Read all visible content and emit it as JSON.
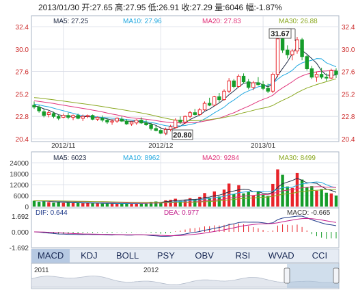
{
  "header": "2013/01/30 开:27.65 高:27.95 低:26.91 收:27.29 量:6046 幅:-1.87%",
  "colors": {
    "up": "#e8242a",
    "down": "#159c2a",
    "ma5": "#1f2a44",
    "ma10": "#21a8e0",
    "ma20": "#e0337a",
    "ma30": "#8aa81f",
    "grid": "#d8dce6",
    "axis": "#6d7a8a",
    "price_label": "#cc2a2a"
  },
  "price_panel": {
    "legend": [
      {
        "key": "ma5",
        "text": "MA5: 27.25"
      },
      {
        "key": "ma10",
        "text": "MA10: 27.96"
      },
      {
        "key": "ma20",
        "text": "MA20: 27.83"
      },
      {
        "key": "ma30",
        "text": "MA30: 26.88"
      }
    ],
    "y_ticks": [
      "32.4",
      "30.0",
      "27.6",
      "25.2",
      "22.8",
      "20.4"
    ],
    "x_ticks": [
      "2012/11",
      "2012/12",
      "2013/01"
    ],
    "high_callout": "31.67",
    "low_callout": "20.80"
  },
  "volume_panel": {
    "legend": [
      {
        "key": "ma5",
        "text": "MA5: 6023"
      },
      {
        "key": "ma10",
        "text": "MA10: 8962"
      },
      {
        "key": "ma20",
        "text": "MA20: 9284"
      },
      {
        "key": "ma30",
        "text": "MA30: 8499"
      }
    ],
    "y_ticks": [
      "24000",
      "18000",
      "12000",
      "6000",
      "0"
    ]
  },
  "macd_panel": {
    "dif": "DIF: 0.644",
    "dea": "DEA: 0.977",
    "macd": "MACD: -0.665",
    "y_ticks": [
      "1.692",
      "0.000",
      "-1.692"
    ]
  },
  "tabs": [
    "MACD",
    "KDJ",
    "BOLL",
    "PSY",
    "OBV",
    "RSI",
    "WVAD",
    "CCI"
  ],
  "active_tab": "MACD",
  "navigator": {
    "labels": [
      "2011",
      "2012"
    ]
  },
  "chart_data": [
    {
      "type": "candlestick",
      "ylim": [
        20.4,
        32.4
      ],
      "ohlc": [
        [
          24.0,
          24.4,
          23.6,
          23.8
        ],
        [
          23.8,
          24.0,
          23.2,
          23.4
        ],
        [
          23.3,
          23.6,
          22.7,
          22.9
        ],
        [
          23.0,
          23.4,
          22.7,
          23.2
        ],
        [
          23.1,
          23.3,
          22.6,
          22.8
        ],
        [
          22.8,
          23.0,
          22.4,
          22.6
        ],
        [
          22.7,
          23.1,
          22.6,
          22.9
        ],
        [
          22.9,
          23.2,
          22.5,
          22.7
        ],
        [
          22.7,
          23.0,
          22.4,
          22.9
        ],
        [
          22.9,
          23.1,
          22.5,
          22.6
        ],
        [
          22.6,
          23.0,
          22.3,
          22.8
        ],
        [
          22.8,
          23.0,
          22.6,
          22.9
        ],
        [
          22.9,
          23.0,
          22.4,
          22.5
        ],
        [
          22.5,
          22.8,
          22.3,
          22.7
        ],
        [
          22.6,
          22.9,
          22.2,
          22.4
        ],
        [
          22.4,
          22.6,
          22.0,
          22.2
        ],
        [
          22.2,
          22.5,
          21.9,
          22.3
        ],
        [
          22.3,
          22.7,
          22.1,
          22.6
        ],
        [
          22.5,
          22.8,
          22.2,
          22.3
        ],
        [
          22.3,
          22.5,
          21.9,
          22.0
        ],
        [
          22.0,
          22.3,
          21.8,
          22.2
        ],
        [
          22.1,
          22.5,
          21.9,
          22.4
        ],
        [
          22.4,
          22.7,
          22.0,
          22.1
        ],
        [
          22.1,
          22.4,
          21.8,
          21.9
        ],
        [
          21.9,
          22.1,
          21.3,
          21.5
        ],
        [
          21.5,
          21.8,
          21.2,
          21.3
        ],
        [
          21.3,
          21.5,
          20.9,
          21.0
        ],
        [
          21.0,
          21.6,
          20.8,
          21.4
        ],
        [
          21.4,
          21.9,
          21.2,
          21.7
        ],
        [
          21.6,
          22.6,
          21.5,
          22.4
        ],
        [
          22.4,
          22.8,
          22.0,
          22.2
        ],
        [
          22.2,
          22.9,
          22.0,
          22.8
        ],
        [
          22.8,
          23.4,
          22.6,
          23.2
        ],
        [
          23.2,
          23.6,
          22.9,
          23.0
        ],
        [
          23.0,
          23.7,
          22.9,
          23.5
        ],
        [
          23.5,
          24.4,
          23.4,
          24.2
        ],
        [
          24.2,
          24.8,
          23.9,
          24.0
        ],
        [
          24.0,
          25.0,
          23.9,
          24.9
        ],
        [
          24.9,
          25.3,
          24.3,
          24.6
        ],
        [
          24.6,
          25.7,
          24.5,
          25.5
        ],
        [
          25.5,
          26.9,
          25.3,
          26.6
        ],
        [
          26.6,
          26.8,
          25.8,
          26.0
        ],
        [
          26.0,
          27.3,
          25.9,
          27.1
        ],
        [
          27.1,
          27.4,
          26.3,
          26.5
        ],
        [
          26.5,
          26.8,
          25.7,
          25.9
        ],
        [
          25.9,
          26.6,
          25.6,
          26.4
        ],
        [
          26.4,
          27.0,
          26.1,
          26.2
        ],
        [
          26.2,
          26.6,
          25.6,
          25.8
        ],
        [
          25.8,
          26.3,
          25.3,
          25.5
        ],
        [
          25.5,
          27.5,
          25.3,
          27.3
        ],
        [
          27.3,
          31.67,
          27.0,
          31.1
        ],
        [
          31.1,
          31.3,
          29.6,
          29.9
        ],
        [
          29.9,
          30.4,
          29.0,
          29.4
        ],
        [
          29.4,
          30.0,
          28.8,
          29.8
        ],
        [
          29.8,
          31.3,
          29.5,
          31.0
        ],
        [
          31.0,
          31.2,
          28.8,
          29.2
        ],
        [
          29.2,
          29.4,
          27.7,
          27.9
        ],
        [
          27.9,
          28.2,
          26.8,
          27.0
        ],
        [
          27.0,
          27.6,
          26.5,
          27.3
        ],
        [
          27.3,
          28.0,
          26.8,
          27.0
        ],
        [
          27.0,
          27.4,
          26.6,
          26.9
        ],
        [
          26.9,
          27.9,
          26.8,
          27.7
        ],
        [
          27.65,
          27.95,
          26.91,
          27.29
        ]
      ],
      "volume_ylim": [
        0,
        24000
      ],
      "volume": [
        3200,
        2600,
        2900,
        2400,
        2100,
        2300,
        2000,
        2200,
        1900,
        2100,
        1800,
        2000,
        1700,
        1900,
        1600,
        1800,
        1700,
        1500,
        1700,
        1900,
        1600,
        1800,
        1700,
        2300,
        2600,
        2800,
        2400,
        3400,
        3700,
        4300,
        3100,
        3700,
        4600,
        3900,
        5300,
        7400,
        4800,
        8300,
        5500,
        9300,
        12600,
        6900,
        11700,
        7200,
        8300,
        6200,
        8100,
        6400,
        5800,
        12400,
        20400,
        17400,
        11000,
        10200,
        18400,
        14800,
        10600,
        11200,
        8700,
        9600,
        7600,
        7200,
        6046
      ],
      "macd_ylim": [
        -1.692,
        1.692
      ]
    }
  ]
}
